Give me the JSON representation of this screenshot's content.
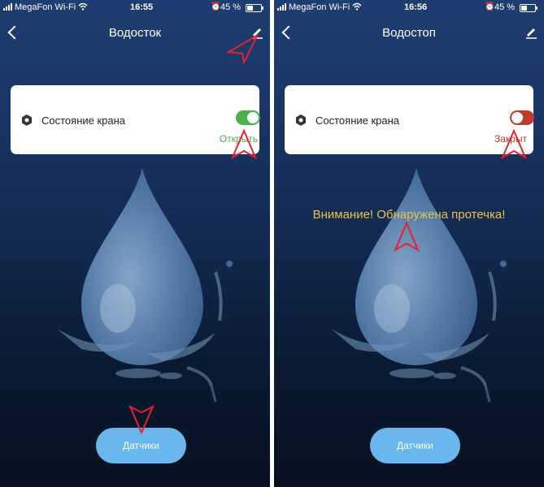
{
  "screens": [
    {
      "status": {
        "carrier": "MegaFon Wi-Fi",
        "time": "16:55",
        "battery": "45 %",
        "battery_level": 0.45
      },
      "nav": {
        "title": "Водосток"
      },
      "card": {
        "label": "Состояние крана",
        "toggle_on": true,
        "state_text": "Открыть",
        "state_color": "#4caf50"
      },
      "warning": "",
      "sensors_button": "Датчики"
    },
    {
      "status": {
        "carrier": "MegaFon Wi-Fi",
        "time": "16:56",
        "battery": "45 %",
        "battery_level": 0.45
      },
      "nav": {
        "title": "Водостоп"
      },
      "card": {
        "label": "Состояние крана",
        "toggle_on": false,
        "state_text": "Закрыт",
        "state_color": "#c0392b"
      },
      "warning": "Внимание! Обнаружена протечка!",
      "sensors_button": "Датчики"
    }
  ],
  "colors": {
    "accent": "#6ab6ee",
    "annotation": "#e8212b",
    "warning": "#e8c24a"
  }
}
